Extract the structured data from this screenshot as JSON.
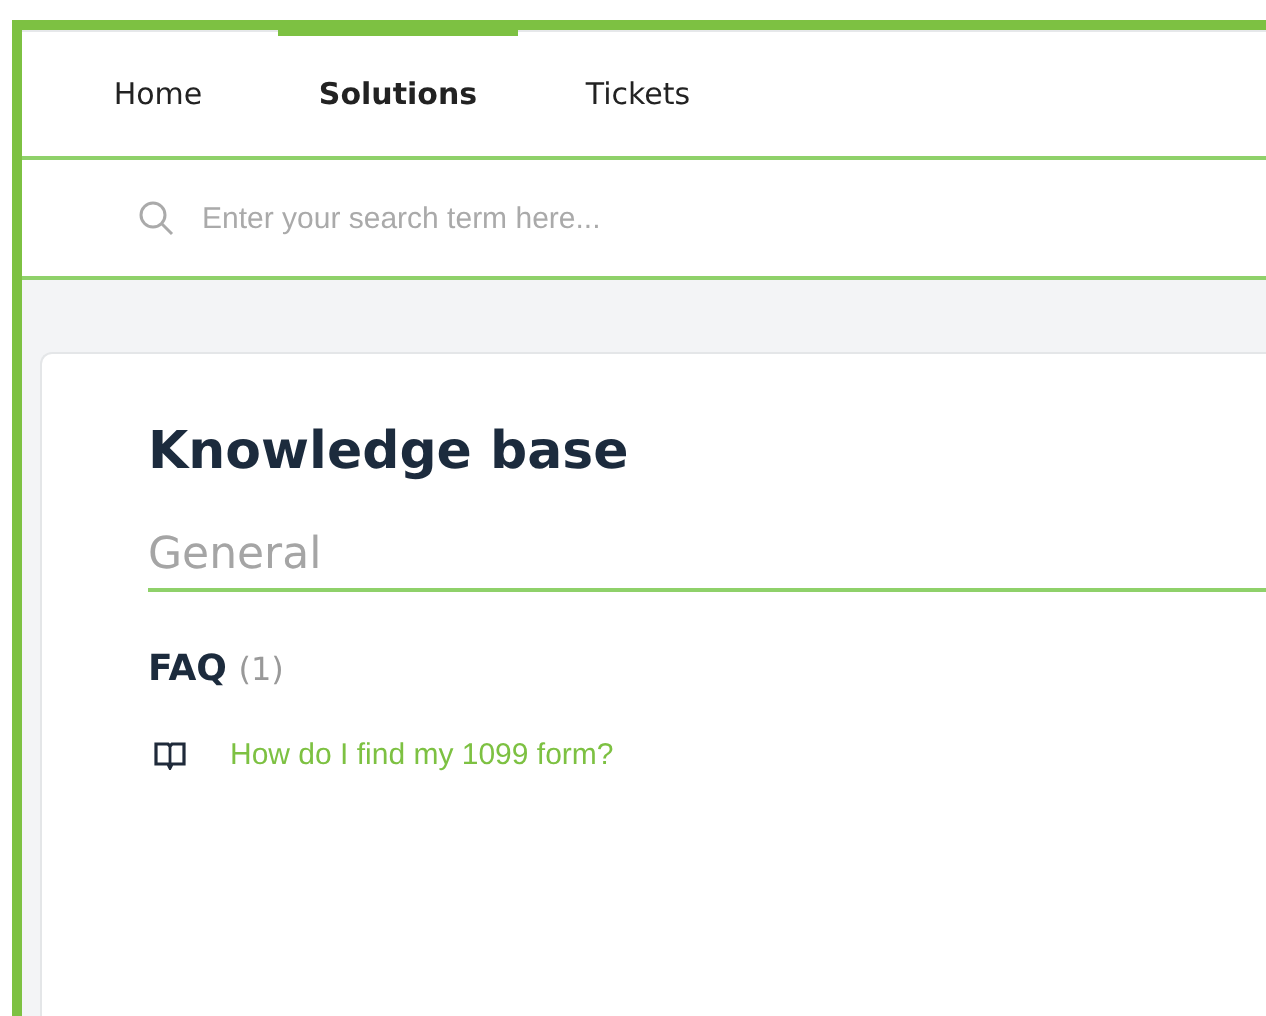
{
  "tabs": [
    {
      "label": "Home",
      "selected": false
    },
    {
      "label": "Solutions",
      "selected": true
    },
    {
      "label": "Tickets",
      "selected": false
    }
  ],
  "search": {
    "placeholder": "Enter your search term here..."
  },
  "knowledge_base": {
    "title": "Knowledge base",
    "category": "General",
    "sections": [
      {
        "title": "FAQ",
        "count": "(1)",
        "articles": [
          {
            "title": "How do I find my 1099 form?"
          }
        ]
      }
    ]
  }
}
